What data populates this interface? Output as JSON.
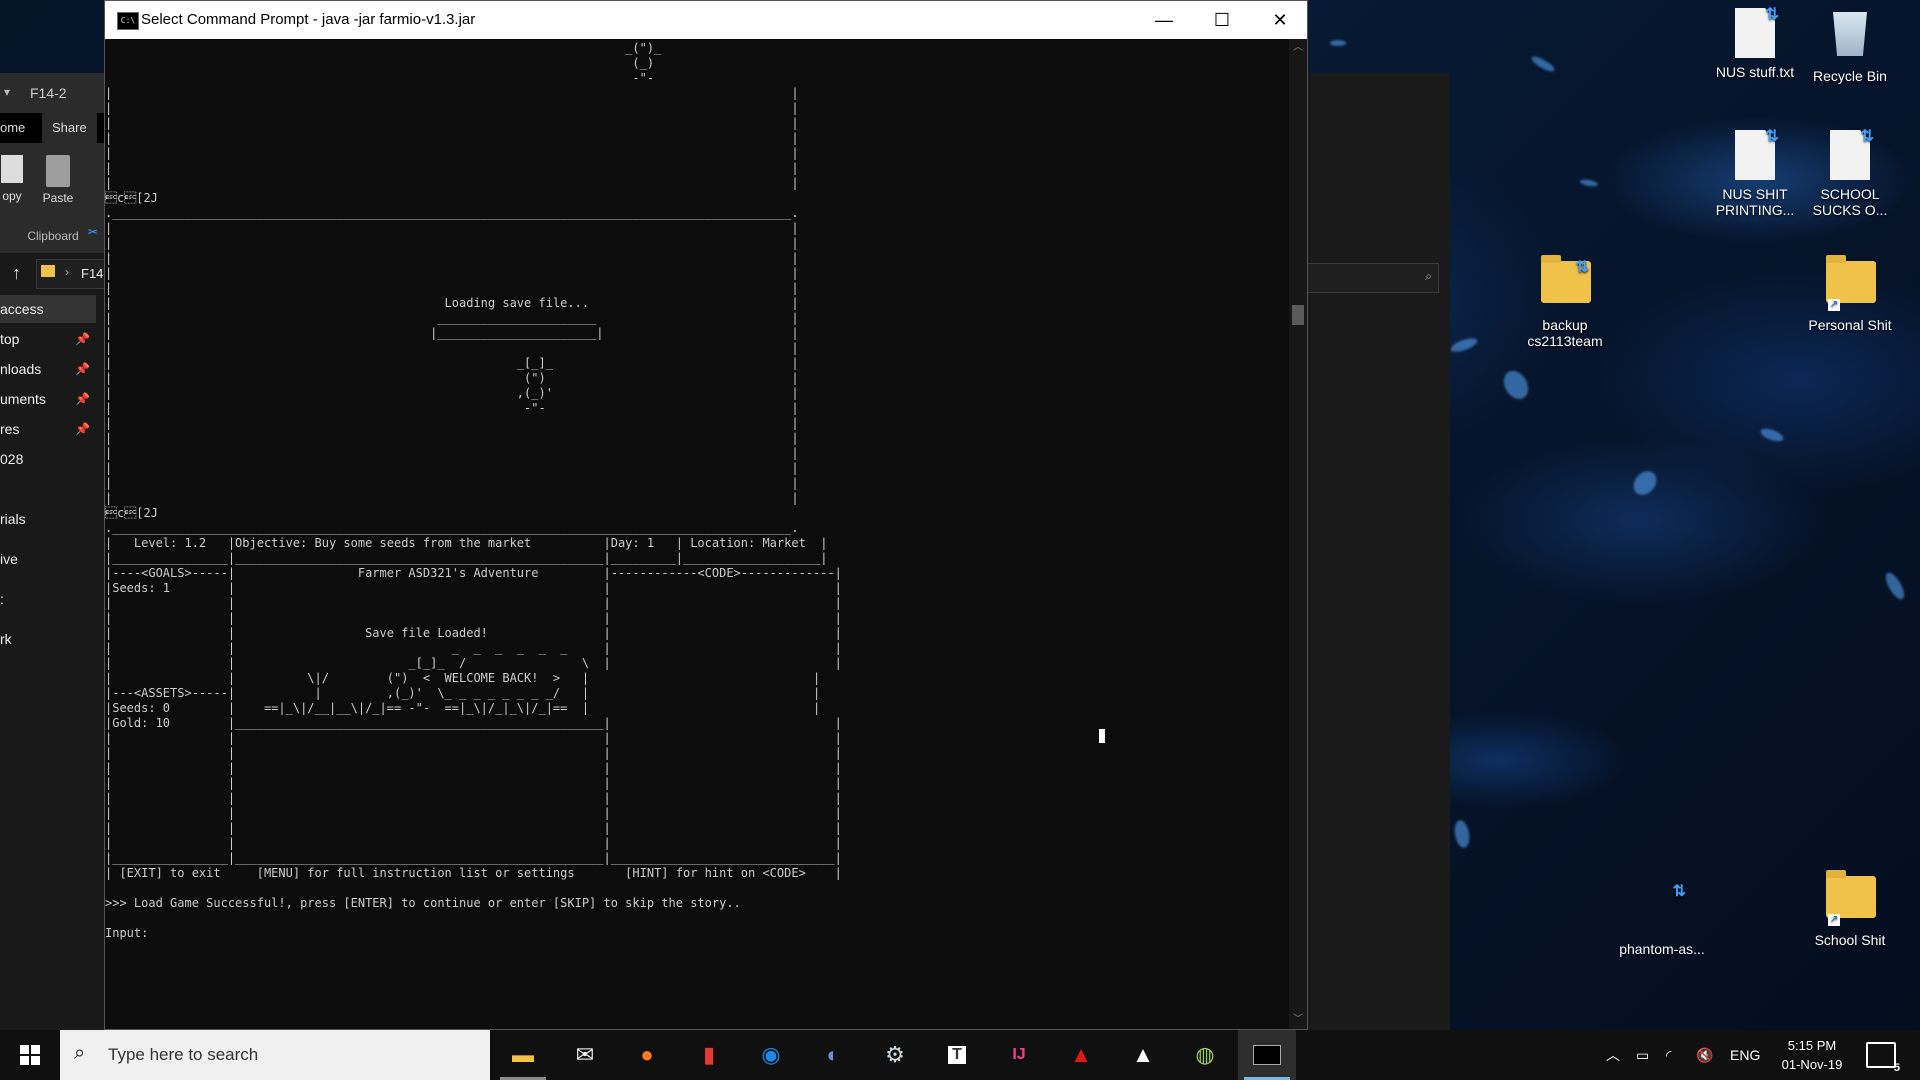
{
  "cmd_window": {
    "title": "Select Command Prompt - java  -jar farmio-v1.3.jar",
    "icon_label": "C:\\",
    "minimize": "—",
    "maximize": "☐",
    "close": "✕",
    "console_text": "                                                                        _(\")_\n                                                                         (_)\n                                                                         -\"-\n|                                                                                              |\n|                                                                                              |\n|                                                                                              |\n|                                                                                              |\n|                                                                                              |\n|                                                                                              |\n|                                                                                              |\n\u001bc\u001b[2J\n.______________________________________________________________________________________________.\n|                                                                                              |\n|                                                                                              |\n|                                                                                              |\n|                                                                                              |\n|                                                                                              |\n|                                              Loading save file...                            |\n|                                             ______________________                           |\n|                                            |______________________|                          |\n|                                                                                              |\n|                                                        _[_]_                                 |\n|                                                         (\")                                  |\n|                                                        ,(_)'                                 |\n|                                                         -\"-                                  |\n|                                                                                              |\n|                                                                                              |\n|                                                                                              |\n|                                                                                              |\n|                                                                                              |\n|                                                                                              |\n\u001bc\u001b[2J\n.______________________________________________________________________________________________.\n|   Level: 1.2   |Objective: Buy some seeds from the market          |Day: 1   | Location: Market  |\n|________________|___________________________________________________|_________|___________________|\n|----<GOALS>-----|                 Farmer ASD321's Adventure         |------------<CODE>-------------|\n|Seeds: 1        |                                                   |                               |\n|                |                                                   |                               |\n|                |                                                   |                               |\n|                |                  Save file Loaded!                |                               |\n|                |                              _  _  _  _  _  _     |                               |\n|                |                        _[_]_  /                \\  |                               |\n|                |          \\|/        (\")  <  WELCOME BACK!  >   |                               |\n|---<ASSETS>-----|           |         ,(_)'  \\_ _ _ _ _ _ _ _/   |                               |\n|Seeds: 0        |    ==|_\\|/__|__\\|/_|== -\"-  ==|_\\|/_|_\\|/_|==  |                               |\n|Gold: 10        |___________________________________________________|                               |\n|                |                                                   |                               |\n|                |                                                   |                               |\n|                |                                                   |                               |\n|                |                                                   |                               |\n|                |                                                   |                               |\n|                |                                                   |                               |\n|                |                                                   |                               |\n|                |                                                   |                               |\n|________________|___________________________________________________|_______________________________|\n| [EXIT] to exit     [MENU] for full instruction list or settings       [HINT] for hint on <CODE>    |\n\n>>> Load Game Successful!, press [ENTER] to continue or enter [SKIP] to skip the story..\n\nInput:"
  },
  "explorer_window": {
    "path": "F14-2",
    "tabs": [
      "ome",
      "Share"
    ],
    "ribbon": {
      "copy": "opy",
      "paste": "Paste",
      "group": "Clipboard"
    },
    "nav_path": "F14",
    "sidebar": [
      "access",
      "top",
      "nloads",
      "uments",
      "res",
      "028",
      "rials",
      "ive",
      ":",
      "rk"
    ]
  },
  "desktop_icons": [
    {
      "label": "NUS stuff.txt",
      "type": "doc"
    },
    {
      "label": "Recycle Bin",
      "type": "bin"
    },
    {
      "label": "NUS SHIT PRINTING...",
      "type": "doc"
    },
    {
      "label": "SCHOOL SUCKS O...",
      "type": "doc"
    },
    {
      "label": "backup cs2113team",
      "type": "folder"
    },
    {
      "label": "Personal Shit",
      "type": "folder"
    },
    {
      "label": "phantom-as...",
      "type": "blank"
    },
    {
      "label": "School Shit",
      "type": "folder"
    }
  ],
  "taskbar": {
    "search_placeholder": "Type here to search",
    "apps": [
      "file-explorer",
      "mail",
      "firefox",
      "pdf-reader",
      "maps",
      "discord",
      "steam",
      "typora",
      "intellij",
      "angular",
      "photos",
      "paint",
      "command-prompt"
    ],
    "language": "ENG",
    "time": "5:15 PM",
    "date": "01-Nov-19",
    "notification_count": "5"
  },
  "colors": {
    "console_bg": "#0c0c0c",
    "console_fg": "#cccccc",
    "accent": "#76b9ed"
  }
}
